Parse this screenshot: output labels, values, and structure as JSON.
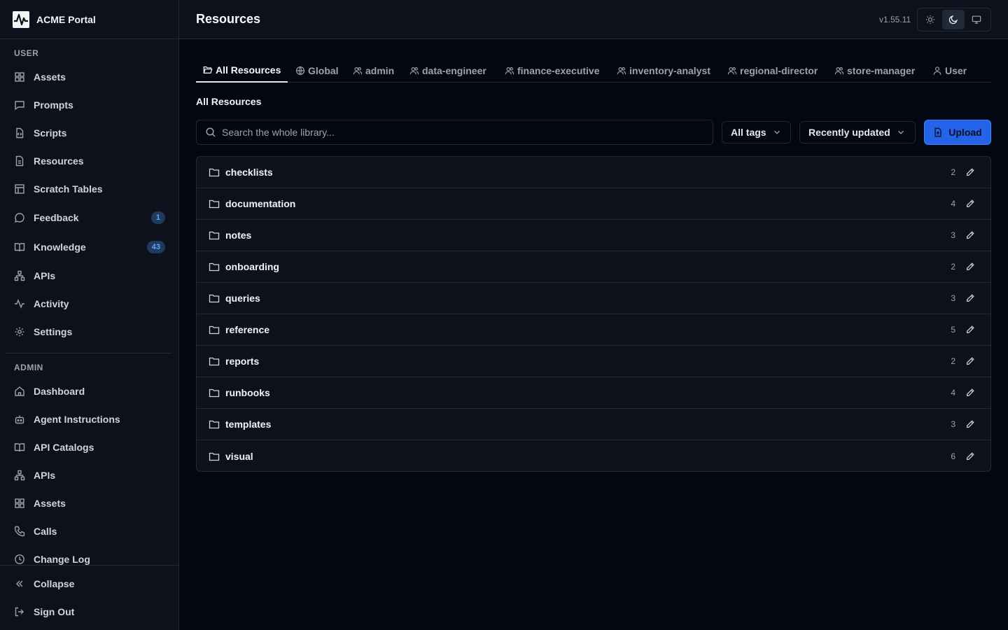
{
  "brand": {
    "name": "ACME Portal"
  },
  "sidebar": {
    "user_label": "USER",
    "user_items": [
      {
        "label": "Assets",
        "icon": "grid-icon"
      },
      {
        "label": "Prompts",
        "icon": "message-square-icon"
      },
      {
        "label": "Scripts",
        "icon": "file-code-icon"
      },
      {
        "label": "Resources",
        "icon": "file-icon"
      },
      {
        "label": "Scratch Tables",
        "icon": "table-icon"
      },
      {
        "label": "Feedback",
        "icon": "message-circle-icon",
        "badge": "1"
      },
      {
        "label": "Knowledge",
        "icon": "book-open-icon",
        "badge": "43"
      },
      {
        "label": "APIs",
        "icon": "network-icon"
      },
      {
        "label": "Activity",
        "icon": "activity-icon"
      },
      {
        "label": "Settings",
        "icon": "gear-icon"
      }
    ],
    "admin_label": "ADMIN",
    "admin_items": [
      {
        "label": "Dashboard",
        "icon": "home-icon"
      },
      {
        "label": "Agent Instructions",
        "icon": "bot-icon"
      },
      {
        "label": "API Catalogs",
        "icon": "book-open-icon"
      },
      {
        "label": "APIs",
        "icon": "network-icon"
      },
      {
        "label": "Assets",
        "icon": "grid-icon"
      },
      {
        "label": "Calls",
        "icon": "phone-icon"
      },
      {
        "label": "Change Log",
        "icon": "clock-icon"
      }
    ],
    "footer": {
      "collapse": "Collapse",
      "sign_out": "Sign Out"
    }
  },
  "header": {
    "title": "Resources",
    "version": "v1.55.11"
  },
  "tabs": [
    {
      "label": "All Resources",
      "icon": "folder-open-icon",
      "active": true
    },
    {
      "label": "Global",
      "icon": "globe-icon"
    },
    {
      "label": "admin",
      "icon": "users-icon"
    },
    {
      "label": "data-engineer",
      "icon": "users-icon"
    },
    {
      "label": "finance-executive",
      "icon": "users-icon"
    },
    {
      "label": "inventory-analyst",
      "icon": "users-icon"
    },
    {
      "label": "regional-director",
      "icon": "users-icon"
    },
    {
      "label": "store-manager",
      "icon": "users-icon"
    },
    {
      "label": "User",
      "icon": "user-icon"
    }
  ],
  "main": {
    "section_title": "All Resources",
    "search_placeholder": "Search the whole library...",
    "tag_filter": "All tags",
    "sort": "Recently updated",
    "upload_label": "Upload"
  },
  "folders": [
    {
      "name": "checklists",
      "count": "2"
    },
    {
      "name": "documentation",
      "count": "4"
    },
    {
      "name": "notes",
      "count": "3"
    },
    {
      "name": "onboarding",
      "count": "2"
    },
    {
      "name": "queries",
      "count": "3"
    },
    {
      "name": "reference",
      "count": "5"
    },
    {
      "name": "reports",
      "count": "2"
    },
    {
      "name": "runbooks",
      "count": "4"
    },
    {
      "name": "templates",
      "count": "3"
    },
    {
      "name": "visual",
      "count": "6"
    }
  ],
  "colors": {
    "background": "#030712",
    "surface": "#0c111b",
    "border": "#1f2937",
    "accent": "#2563eb",
    "badge_text": "#60a5fa"
  }
}
